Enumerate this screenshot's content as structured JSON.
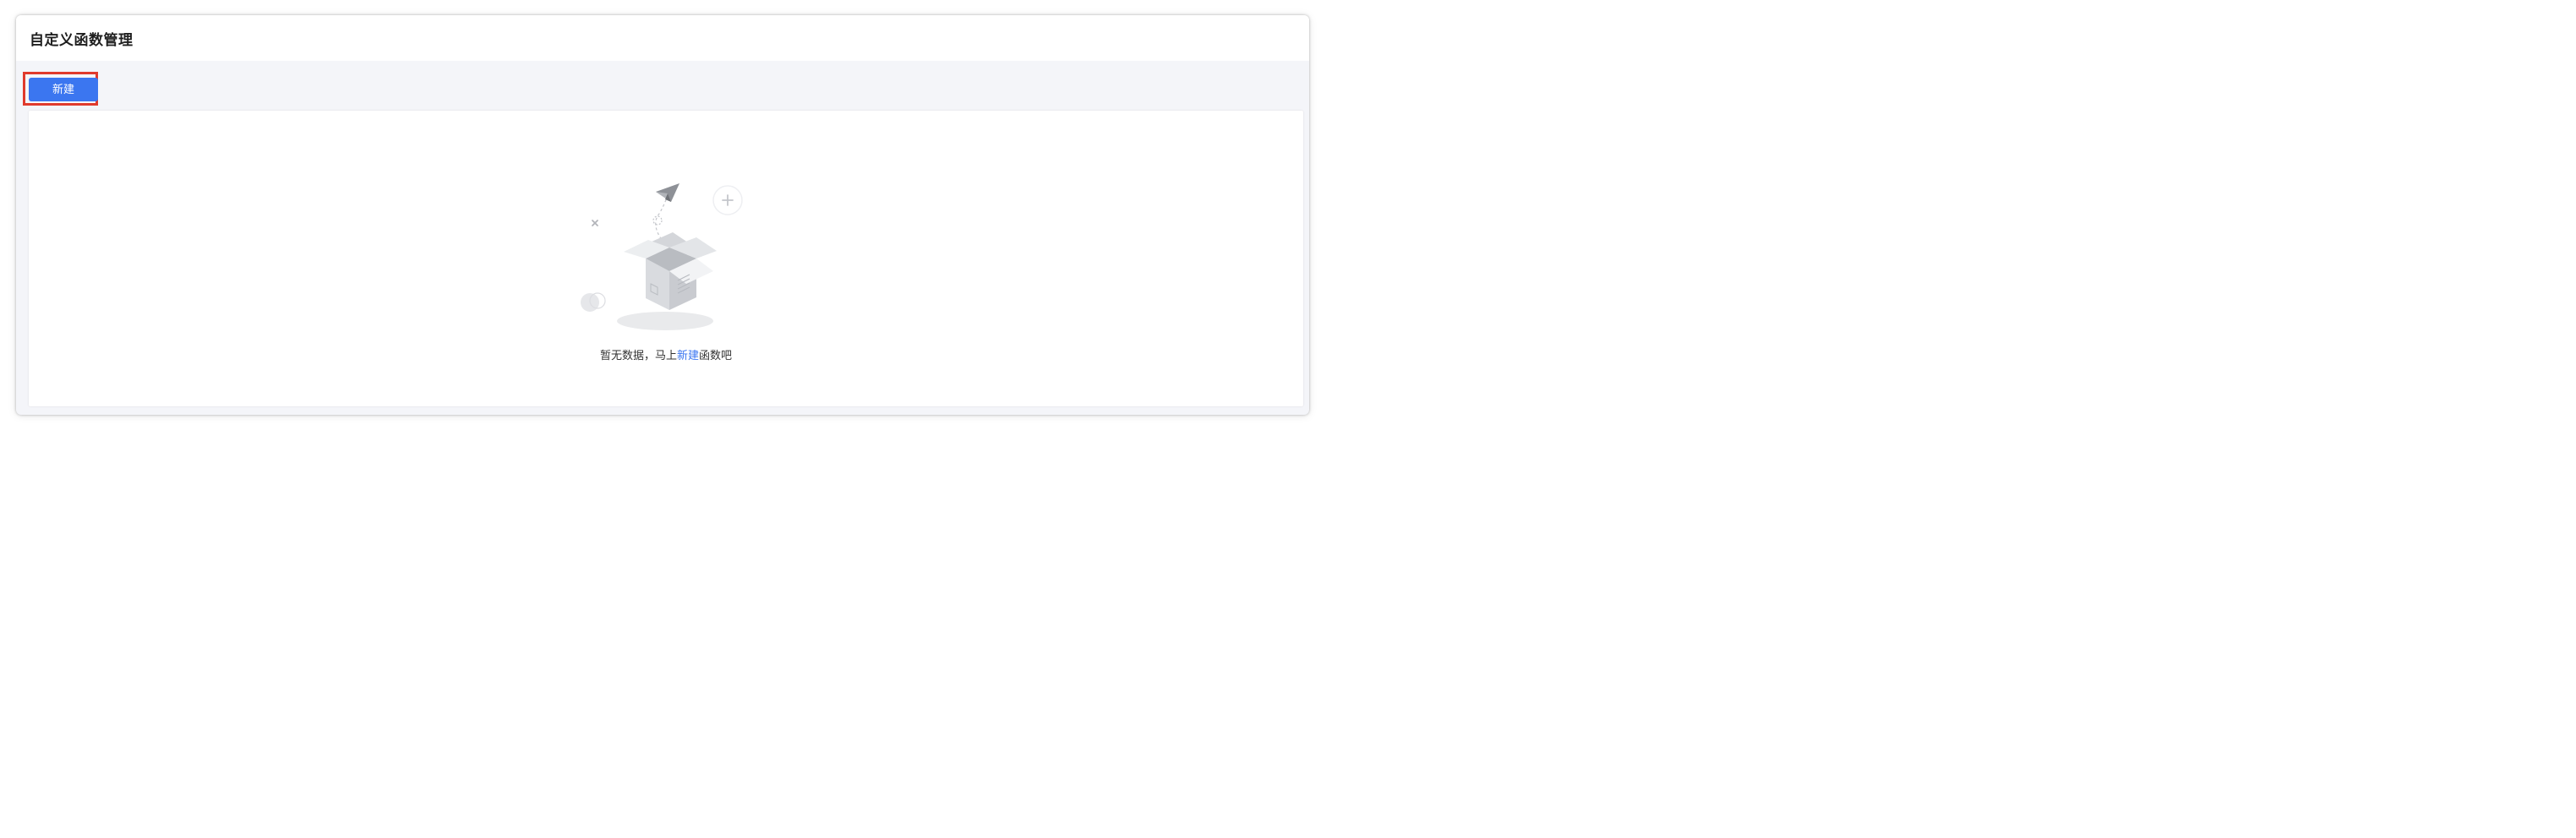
{
  "page": {
    "title": "自定义函数管理"
  },
  "toolbar": {
    "new_label": "新建"
  },
  "empty_state": {
    "text_before": "暂无数据，马上",
    "link_label": "新建",
    "text_after": "函数吧",
    "illustration": "empty-box-icon"
  },
  "colors": {
    "primary": "#3b76f0",
    "highlight": "#e03a2c",
    "toolbar_bg": "#f4f5f9"
  }
}
